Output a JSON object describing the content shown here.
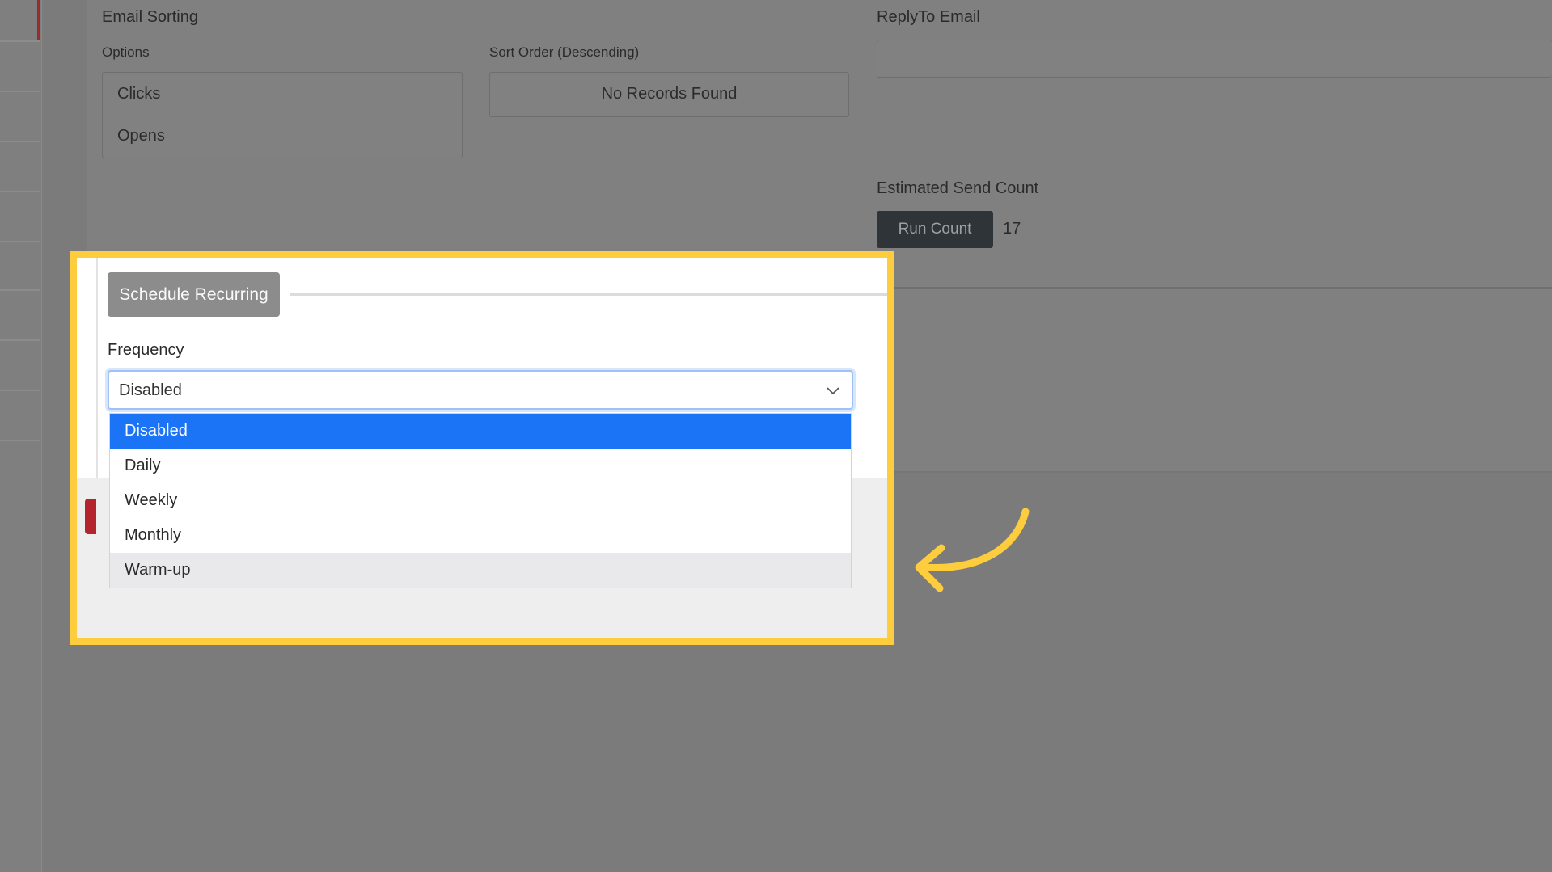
{
  "email_sorting": {
    "title": "Email Sorting",
    "options_label": "Options",
    "options": [
      "Clicks",
      "Opens"
    ],
    "sort_order_label": "Sort Order (Descending)",
    "sort_order_empty": "No Records Found"
  },
  "reply_to": {
    "label": "ReplyTo Email",
    "value": ""
  },
  "send_count": {
    "label": "Estimated Send Count",
    "button": "Run Count",
    "value": "17"
  },
  "schedule": {
    "button": "Schedule Recurring",
    "frequency_label": "Frequency",
    "selected": "Disabled",
    "options": [
      "Disabled",
      "Daily",
      "Weekly",
      "Monthly",
      "Warm-up"
    ],
    "selected_index": 0,
    "hover_index": 4
  },
  "colors": {
    "highlight": "#fdcd3e",
    "selected_option": "#1b74f5",
    "arrow": "#fdcd3e"
  },
  "icons": {
    "select_chevron": "chevron-down-icon",
    "pointer": "curved-arrow-icon"
  }
}
